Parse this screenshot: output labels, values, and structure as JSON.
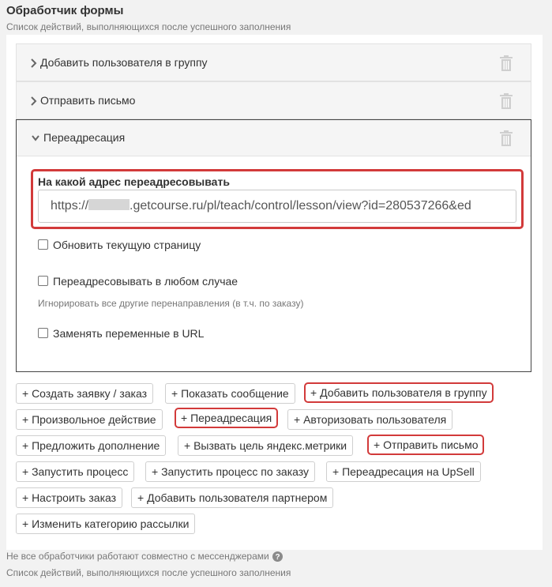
{
  "header": {
    "title": "Обработчик формы",
    "subtitle": "Список действий, выполняющихся после успешного заполнения"
  },
  "accordion": {
    "item1_label": "Добавить пользователя в группу",
    "item2_label": "Отправить письмо",
    "item3_label": "Переадресация"
  },
  "redirect": {
    "field_label": "На какой адрес переадресовывать",
    "url_prefix": "https://",
    "url_suffix": ".getcourse.ru/pl/teach/control/lesson/view?id=280537266&ed",
    "refresh_label": "Обновить текущую страницу",
    "always_label": "Переадресовывать в любом случае",
    "ignore_hint": "Игнорировать все другие перенаправления (в т.ч. по заказу)",
    "replace_vars_label": "Заменять переменные в URL"
  },
  "actions": {
    "create_order": "+ Создать заявку / заказ",
    "show_message": "+ Показать сообщение",
    "add_user_group": "+ Добавить пользователя в группу",
    "custom_action": "+ Произвольное действие",
    "redirect": "+ Переадресация",
    "authorize": "+ Авторизовать пользователя",
    "offer_addon": "+ Предложить дополнение",
    "yandex_goal": "+ Вызвать цель яндекс.метрики",
    "send_email": "+ Отправить письмо",
    "run_process": "+ Запустить процесс",
    "run_process_order": "+ Запустить процесс по заказу",
    "redirect_upsell": "+ Переадресация на UpSell",
    "setup_order": "+ Настроить заказ",
    "add_partner": "+ Добавить пользователя партнером",
    "change_category": "+ Изменить категорию рассылки"
  },
  "footer": {
    "messenger_note": "Не все обработчики работают совместно с мессенджерами",
    "subtitle": "Список действий, выполняющихся после успешного заполнения"
  },
  "colors": {
    "highlight": "#d23a3a",
    "panel_bg": "#ffffff",
    "page_bg": "#f2f2f2"
  }
}
